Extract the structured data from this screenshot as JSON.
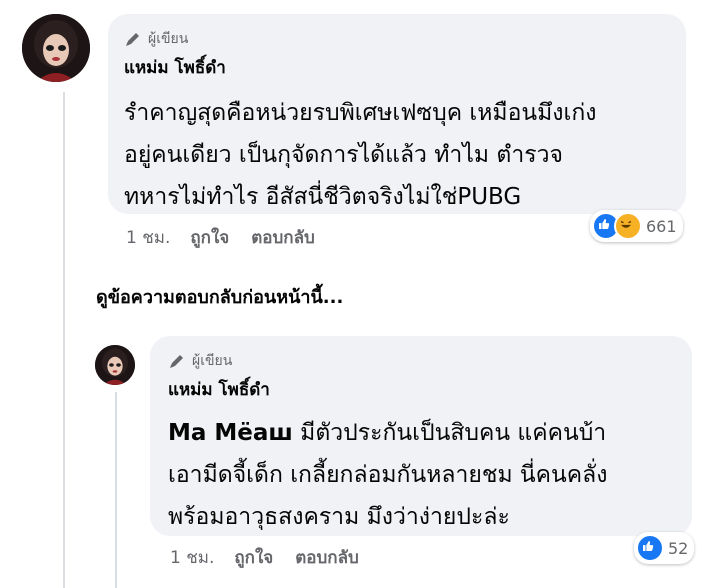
{
  "comments": [
    {
      "badge": "ผู้เขียน",
      "author": "แหม่ม โพธิ์ดำ",
      "lines": [
        "รำคาญสุดคือหน่วยรบพิเศษเฟซบุค เหมือนมึงเก่ง",
        "อยู่คนเดียว เป็นกุจัดการได้แล้ว ทำไม ตำรวจ",
        "ทหารไม่ทำไร อีสัสนี่ชีวิตจริงไม่ใช่PUBG"
      ],
      "time": "1 ชม.",
      "like_label": "ถูกใจ",
      "reply_label": "ตอบกลับ",
      "reaction_count": "661"
    },
    {
      "badge": "ผู้เขียน",
      "author": "แหม่ม โพธิ์ดำ",
      "mention": "Ma Mëaш",
      "lines": [
        "มีตัวประกันเป็นสิบคน แค่คนบ้า",
        "เอามีดจี้เด็ก เกลี้ยกล่อมกันหลายชม นี่คนคลั่ง",
        "พร้อมอาวุธสงคราม มึงว่าง่ายปะล่ะ"
      ],
      "time": "1 ชม.",
      "like_label": "ถูกใจ",
      "reply_label": "ตอบกลับ",
      "reaction_count": "52"
    }
  ],
  "view_previous": "ดูข้อความตอบกลับก่อนหน้านี้...",
  "colors": {
    "bubble": "#f0f2f5",
    "like_blue": "#1877f2",
    "haha_yellow": "#f7b125",
    "muted": "#65676b"
  },
  "icons": [
    "pen-icon",
    "like-reaction-icon",
    "haha-reaction-icon",
    "avatar"
  ]
}
